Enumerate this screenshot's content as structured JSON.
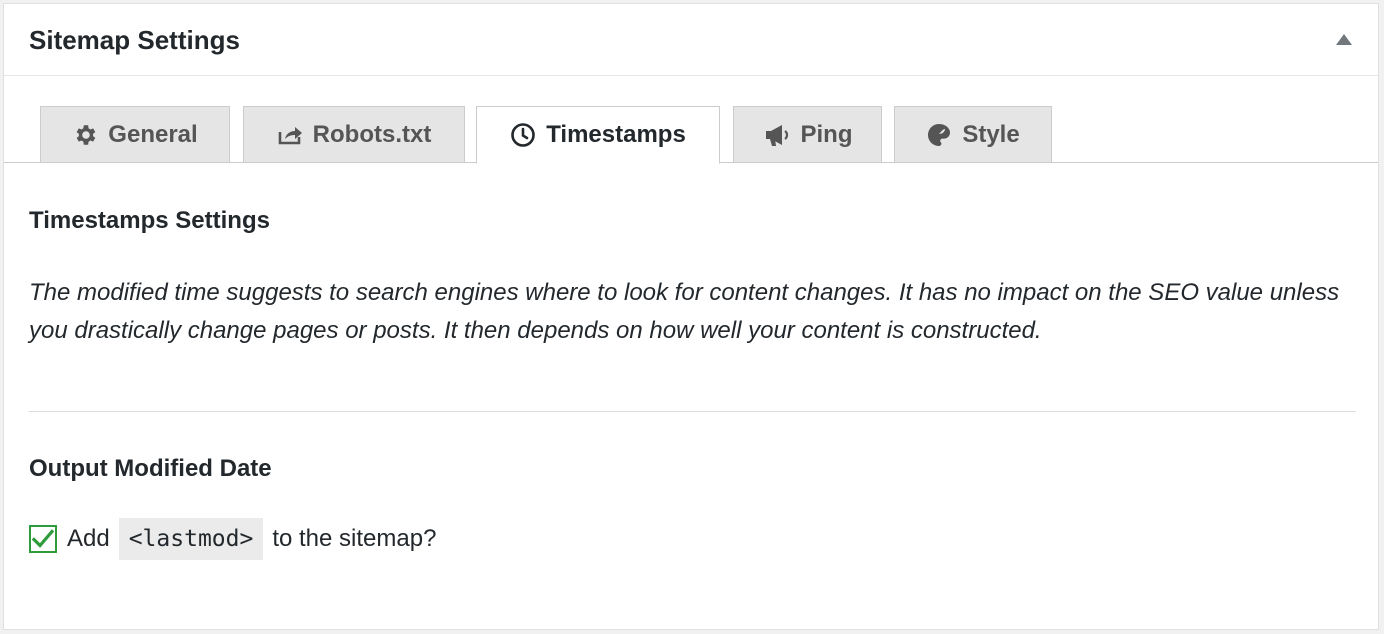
{
  "panel": {
    "title": "Sitemap Settings"
  },
  "tabs": [
    {
      "label": "General",
      "icon": "gear-icon",
      "active": false
    },
    {
      "label": "Robots.txt",
      "icon": "share-icon",
      "active": false
    },
    {
      "label": "Timestamps",
      "icon": "clock-icon",
      "active": true
    },
    {
      "label": "Ping",
      "icon": "megaphone-icon",
      "active": false
    },
    {
      "label": "Style",
      "icon": "palette-icon",
      "active": false
    }
  ],
  "section": {
    "title": "Timestamps Settings",
    "description": "The modified time suggests to search engines where to look for content changes. It has no impact on the SEO value unless you drastically change pages or posts. It then depends on how well your content is constructed."
  },
  "option": {
    "title": "Output Modified Date",
    "checked": true,
    "label_before": "Add",
    "code": "<lastmod>",
    "label_after": "to the sitemap?"
  },
  "colors": {
    "checkbox_accent": "#2e9c3a",
    "tab_inactive_bg": "#e5e5e5",
    "text": "#23282d"
  }
}
